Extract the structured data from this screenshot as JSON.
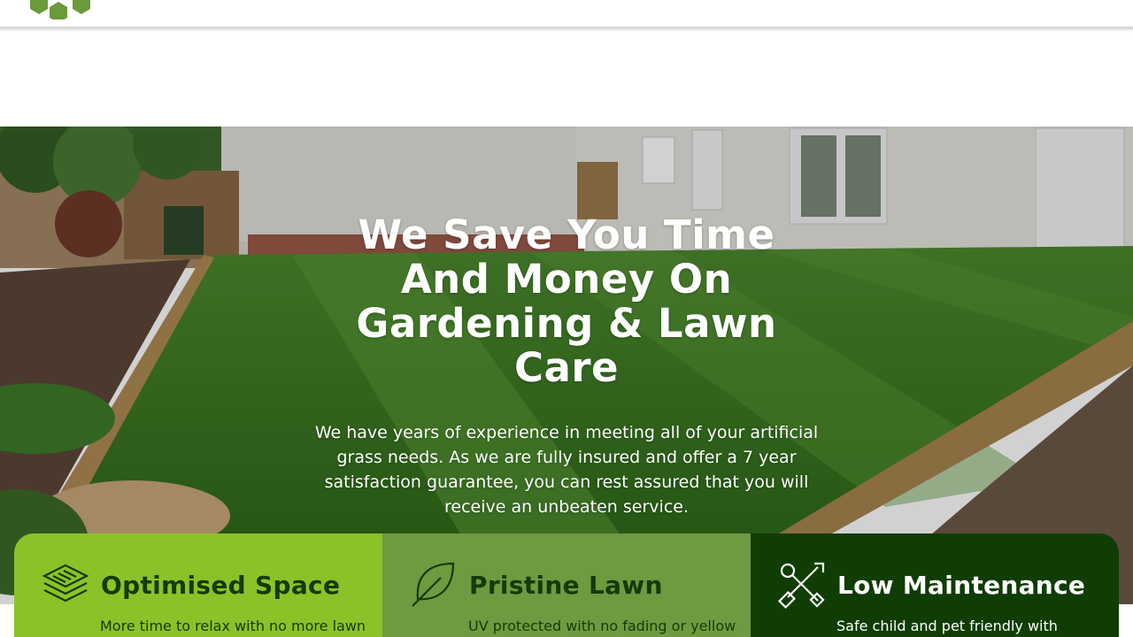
{
  "hero": {
    "title": "We Save You Time And Money On Gardening & Lawn Care",
    "description": "We have years of experience in meeting all of your artificial grass needs. As we are fully insured and offer a 7 year satisfaction guarantee, you can rest assured that you will receive an unbeaten service."
  },
  "features": [
    {
      "title": "Optimised Space",
      "description": "More time to relax with no more lawn",
      "icon": "layers-icon"
    },
    {
      "title": "Pristine Lawn",
      "description": "UV protected with no fading or yellow",
      "icon": "leaf-icon"
    },
    {
      "title": "Low Maintenance",
      "description": "Safe child and pet friendly with",
      "icon": "tools-icon"
    }
  ],
  "colors": {
    "brand_green": "#6a9a3a",
    "feature_1_bg": "#8cc228",
    "feature_2_bg": "#6f9a40",
    "feature_3_bg": "#103d03"
  }
}
